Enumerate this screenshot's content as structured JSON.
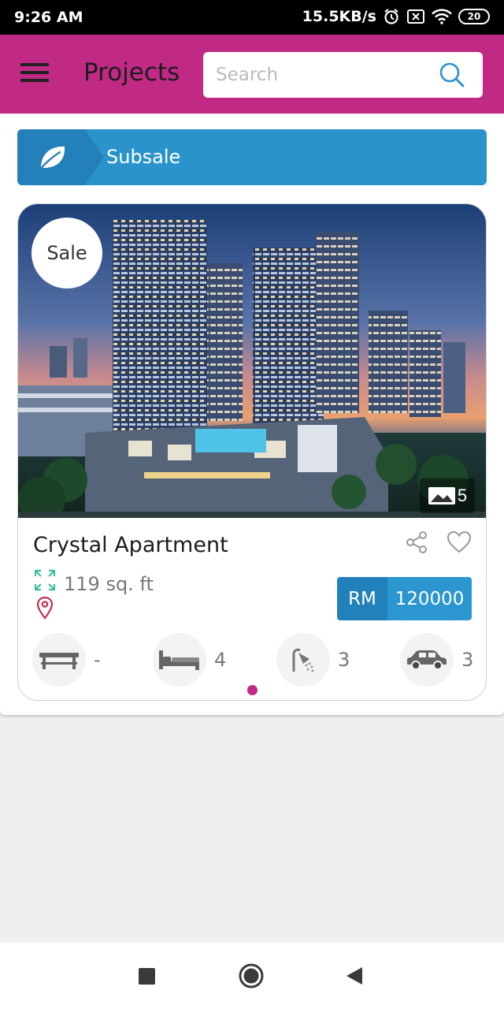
{
  "status_bar": {
    "time": "9:26 AM",
    "network_speed": "15.5KB/s",
    "battery": "20"
  },
  "app_bar": {
    "title": "Projects",
    "menu_icon": "hamburger-menu-icon",
    "search": {
      "placeholder": "Search",
      "value": "",
      "icon": "search-icon"
    }
  },
  "category_banner": {
    "icon": "leaf-icon",
    "label": "Subsale"
  },
  "listing": {
    "badge": "Sale",
    "photo_count": "5",
    "title": "Crystal Apartment",
    "area": "119 sq. ft",
    "price": {
      "currency": "RM",
      "value": "120000"
    },
    "features": [
      {
        "icon": "table-icon",
        "value": "-"
      },
      {
        "icon": "bed-icon",
        "value": "4"
      },
      {
        "icon": "shower-icon",
        "value": "3"
      },
      {
        "icon": "car-icon",
        "value": "3"
      }
    ]
  },
  "colors": {
    "primary": "#c02a85",
    "banner": "#2b93cc",
    "price_currency": "#2280bb",
    "price_value": "#2c96d0",
    "area_icon": "#3dbf9a",
    "location_icon": "#c0304f"
  },
  "nav_bar": {
    "recents_icon": "square-recents-icon",
    "home_icon": "circle-home-icon",
    "back_icon": "triangle-back-icon"
  }
}
